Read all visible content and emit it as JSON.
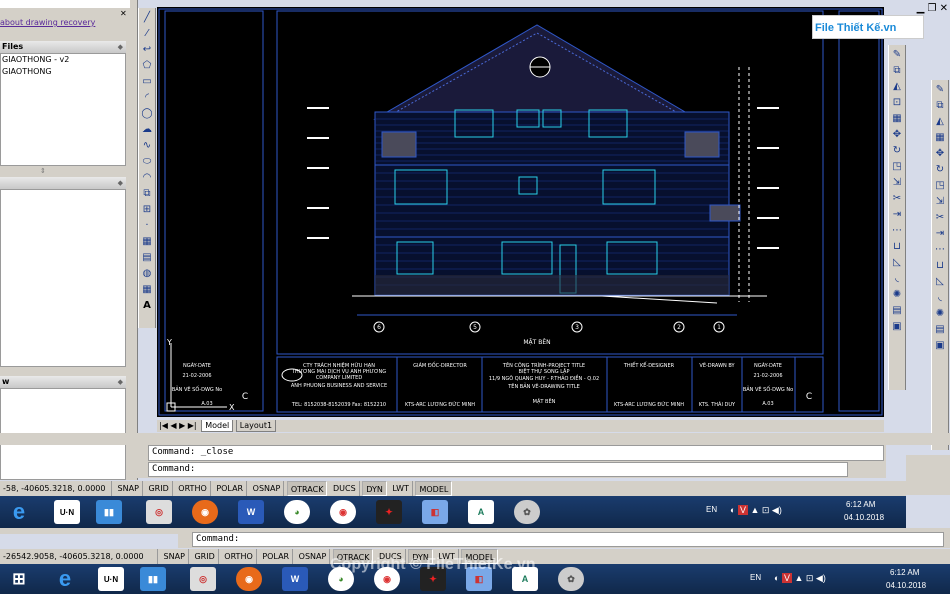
{
  "left_panel": {
    "recovery_link": "about drawing recovery",
    "files_header": "Files",
    "files": [
      "GIAOTHONG - v2",
      "GIAOTHONG"
    ],
    "section3_header": "w"
  },
  "watermark_top": "File Thiết Kế.vn",
  "watermark_bottom": "Copyright © FileThietKe.vn",
  "drawing": {
    "title": "MẶT BÊN",
    "company_line1": "CTY TRÁCH NHIỆM HỮU HẠN",
    "company_line2": "THƯƠNG MẠI DỊCH VỤ ANH PHƯƠNG",
    "company_line3": "COMPANY LIMITED",
    "company_line4": "ANH PHUONG BUSINESS AND SERVICE",
    "company_tel": "TEL: 8152038-8152039 Fax: 8152210",
    "director_label": "GIÁM ĐỐC-DIRECTOR",
    "director_name": "KTS-ARC LƯƠNG ĐỨC MINH",
    "project_label": "TÊN CÔNG TRÌNH-PROJECT TITLE",
    "project_name": "BIỆT THỰ SONG LẬP",
    "project_addr": "11/9 NGÔ QUANG HUY - P.THẢO ĐIỀN - Q.02",
    "drawing_title_label": "TÊN BẢN VẼ-DRAWING TITLE",
    "drawing_title": "MẶT BÊN",
    "designer_label": "THIẾT KẾ-DESIGNER",
    "designer_name": "KTS-ARC LƯƠNG ĐỨC MINH",
    "drawn_label": "VẼ-DRAWN BY",
    "drawn_name": "KTS. THÁI DUY",
    "date_label": "NGÀY-DATE",
    "date_value": "21-02-2006",
    "dwg_label": "BẢN VẼ SỐ-DWG No",
    "dwg_value": "A.03",
    "sheet": "C",
    "grid_marks": [
      "6",
      "5",
      "3",
      "2",
      "1"
    ]
  },
  "tabs": {
    "model": "Model",
    "layout": "Layout1"
  },
  "cmd_top": {
    "line1": "Command:  _close",
    "line2": "Command:"
  },
  "status_top": {
    "coords": "-58, -40605.3218, 0.0000",
    "buttons": [
      "SNAP",
      "GRID",
      "ORTHO",
      "POLAR",
      "OSNAP",
      "OTRACK",
      "DUCS",
      "DYN",
      "LWT",
      "MODEL"
    ]
  },
  "taskbar_top": {
    "lang": "EN",
    "time": "6:12 AM",
    "date": "04.10.2018"
  },
  "cmd_bottom": {
    "line1": "Command:"
  },
  "status_bottom": {
    "coords": "-26542.9058, -40605.3218, 0.0000",
    "buttons": [
      "SNAP",
      "GRID",
      "ORTHO",
      "POLAR",
      "OSNAP",
      "OTRACK",
      "DUCS",
      "DYN",
      "LWT",
      "MODEL"
    ]
  },
  "taskbar_bottom": {
    "lang": "EN",
    "time": "6:12 AM",
    "date": "04.10.2018"
  },
  "colors": {
    "cad_bg": "#000000",
    "cad_line": "#2f57c8",
    "cad_cyan": "#2ad0e8",
    "taskbar": "#10284a"
  }
}
